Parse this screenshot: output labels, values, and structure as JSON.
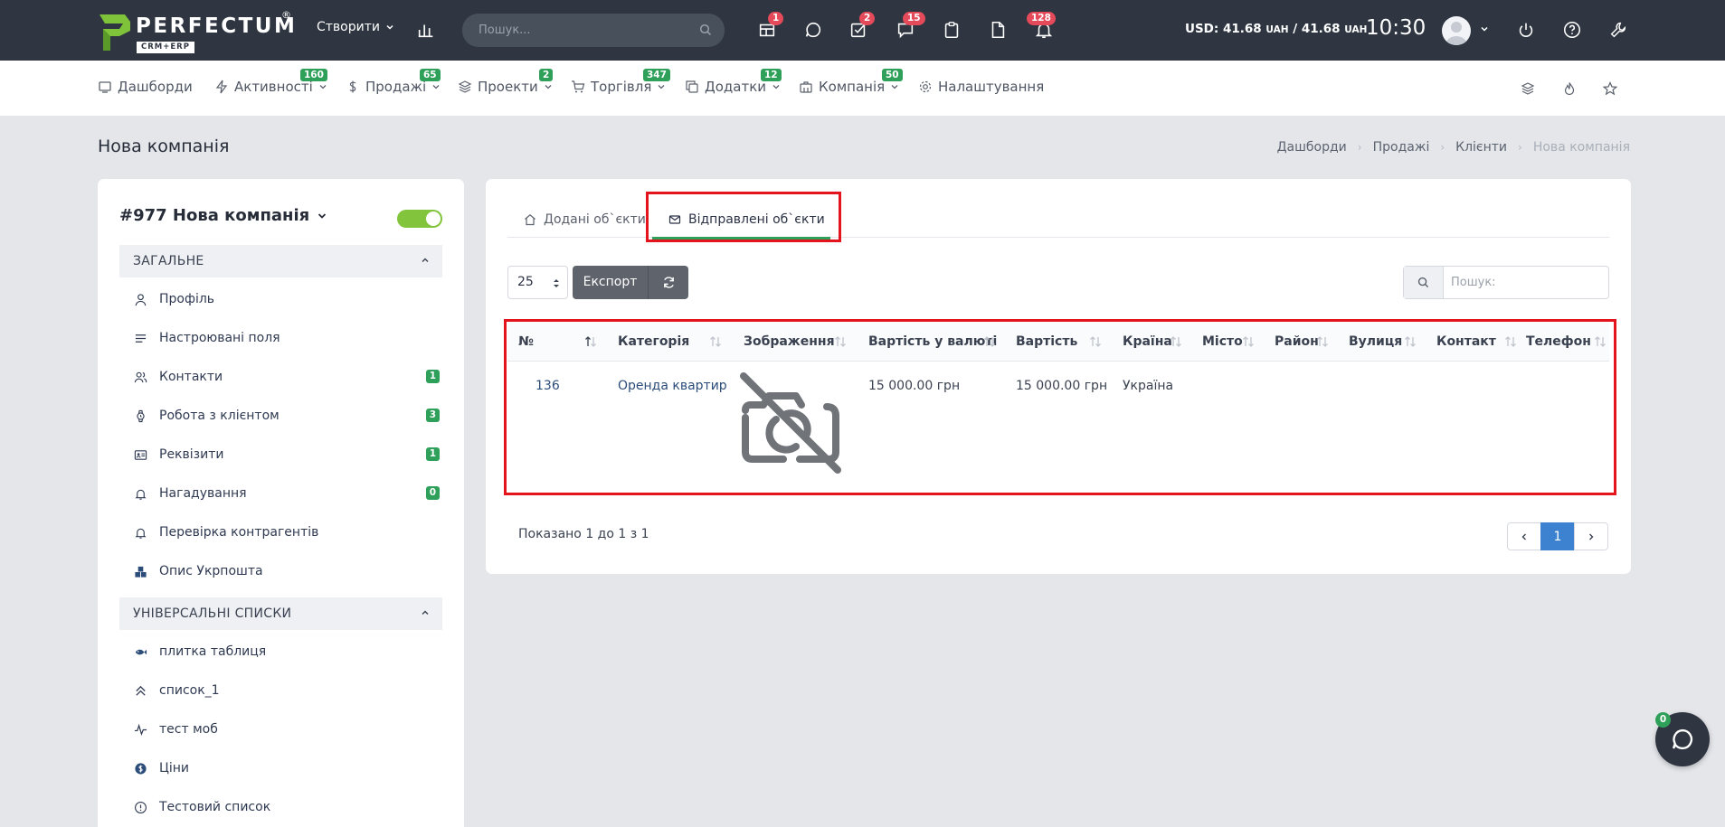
{
  "header": {
    "logo_text": "PERFECTUM",
    "logo_reg": "®",
    "logo_sub": "CRM+ERP",
    "create_label": "Створити",
    "search_placeholder": "Пошук...",
    "badges": {
      "widgets": "1",
      "tasks": "2",
      "messages": "15",
      "notifications": "128"
    },
    "currency": {
      "prefix": "USD: ",
      "val1": "41.68",
      "unit1": "UAH",
      "sep": " / ",
      "val2": "41.68",
      "unit2": "UAH"
    },
    "time": "10:30"
  },
  "nav": [
    {
      "label": "Дашборди",
      "icon": "dashboard-icon",
      "badge": ""
    },
    {
      "label": "Активності",
      "icon": "activity-icon",
      "badge": "160"
    },
    {
      "label": "Продажі",
      "icon": "dollar-icon",
      "badge": "65"
    },
    {
      "label": "Проекти",
      "icon": "layers-icon",
      "badge": "2"
    },
    {
      "label": "Торгівля",
      "icon": "cart-icon",
      "badge": "347"
    },
    {
      "label": "Додатки",
      "icon": "copy-icon",
      "badge": "12"
    },
    {
      "label": "Компанія",
      "icon": "briefcase-icon",
      "badge": "50"
    },
    {
      "label": "Налаштування",
      "icon": "gear-icon",
      "badge": ""
    }
  ],
  "page": {
    "title": "Нова компанія",
    "breadcrumb": [
      "Дашборди",
      "Продажі",
      "Клієнти",
      "Нова компанія"
    ]
  },
  "client": {
    "title": "#977 Нова компанія",
    "sections": [
      {
        "title": "ЗАГАЛЬНЕ",
        "items": [
          {
            "label": "Профіль",
            "icon": "user-icon",
            "count": ""
          },
          {
            "label": "Настроювані поля",
            "icon": "lines-icon",
            "count": ""
          },
          {
            "label": "Контакти",
            "icon": "users-icon",
            "count": "1"
          },
          {
            "label": "Робота з клієнтом",
            "icon": "watch-icon",
            "count": "3"
          },
          {
            "label": "Реквізити",
            "icon": "id-card-icon",
            "count": "1"
          },
          {
            "label": "Нагадування",
            "icon": "bell-icon",
            "count": "0"
          },
          {
            "label": "Перевірка контрагентів",
            "icon": "bell-icon",
            "count": ""
          },
          {
            "label": "Опис Укрпошта",
            "icon": "boxes-icon",
            "count": ""
          }
        ]
      },
      {
        "title": "УНІВЕРСАЛЬНІ СПИСКИ",
        "items": [
          {
            "label": "плитка таблиця",
            "icon": "fish-icon"
          },
          {
            "label": "список_1",
            "icon": "double-chevron-up-icon"
          },
          {
            "label": "тест моб",
            "icon": "pulse-icon"
          },
          {
            "label": "Ціни",
            "icon": "coin-icon"
          },
          {
            "label": "Тестовий список",
            "icon": "info-circle-icon"
          }
        ]
      }
    ]
  },
  "tabs": [
    {
      "label": "Додані об`єкти",
      "icon": "home-icon",
      "active": false
    },
    {
      "label": "Відправлені об`єкти",
      "icon": "mail-icon",
      "active": true
    }
  ],
  "toolbar": {
    "page_size": "25",
    "export_label": "Експорт",
    "search_placeholder": "Пошук:"
  },
  "table": {
    "columns": [
      "№",
      "Категорія",
      "Зображення",
      "Вартість у валюті",
      "Вартість",
      "Країна",
      "Місто",
      "Район",
      "Вулиця",
      "Контакт",
      "Телефон"
    ],
    "rows": [
      {
        "no": "136",
        "category": "Оренда квартир",
        "image": "no-image-icon",
        "price_currency": "15 000.00 грн",
        "price": "15 000.00 грн",
        "country": "Україна",
        "city": "",
        "district": "",
        "street": "",
        "contact": "",
        "phone": ""
      }
    ]
  },
  "footer": {
    "info": "Показано 1 до 1 з 1",
    "current_page": "1"
  },
  "chat": {
    "badge": "0"
  },
  "colors": {
    "header_bg": "#2f3641",
    "accent_green": "#2fa05a",
    "badge_red": "#e44a5a",
    "highlight_red": "#e4141c",
    "pager_active": "#3d82d1",
    "toggle_on": "#82c43c"
  }
}
